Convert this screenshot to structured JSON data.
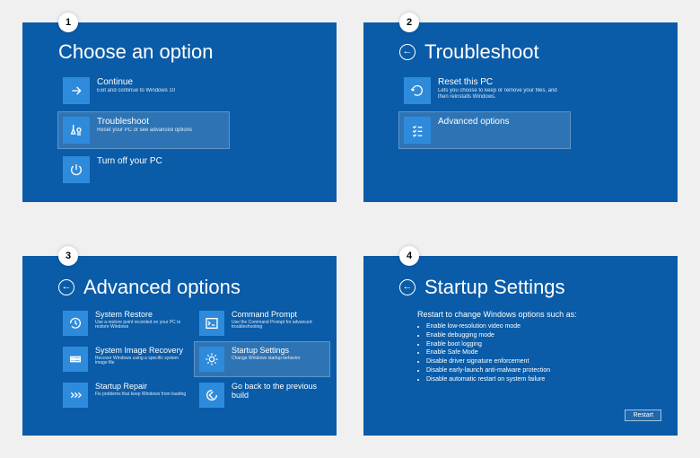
{
  "steps": [
    "1",
    "2",
    "3",
    "4"
  ],
  "panel1": {
    "title": "Choose an option",
    "tiles": [
      {
        "icon": "arrow-right-icon",
        "label": "Continue",
        "desc": "Exit and continue to Windows 10",
        "sel": false
      },
      {
        "icon": "tools-icon",
        "label": "Troubleshoot",
        "desc": "Reset your PC or see advanced options",
        "sel": true
      },
      {
        "icon": "power-icon",
        "label": "Turn off your PC",
        "desc": "",
        "sel": false
      }
    ]
  },
  "panel2": {
    "title": "Troubleshoot",
    "tiles": [
      {
        "icon": "reset-icon",
        "label": "Reset this PC",
        "desc": "Lets you choose to keep or remove your files, and then reinstalls Windows.",
        "sel": false
      },
      {
        "icon": "list-icon",
        "label": "Advanced options",
        "desc": "",
        "sel": true
      }
    ]
  },
  "panel3": {
    "title": "Advanced options",
    "tiles": [
      {
        "icon": "restore-icon",
        "label": "System Restore",
        "desc": "Use a restore point recorded on your PC to restore Windows"
      },
      {
        "icon": "cmd-icon",
        "label": "Command Prompt",
        "desc": "Use the Command Prompt for advanced troubleshooting"
      },
      {
        "icon": "image-icon",
        "label": "System Image Recovery",
        "desc": "Recover Windows using a specific system image file"
      },
      {
        "icon": "gear-icon",
        "label": "Startup Settings",
        "desc": "Change Windows startup behavior",
        "sel": true
      },
      {
        "icon": "repair-icon",
        "label": "Startup Repair",
        "desc": "Fix problems that keep Windows from loading"
      },
      {
        "icon": "back-build-icon",
        "label": "Go back to the previous build",
        "desc": ""
      }
    ]
  },
  "panel4": {
    "title": "Startup Settings",
    "subtitle": "Restart to change Windows options such as:",
    "bullets": [
      "Enable low-resolution video mode",
      "Enable debugging mode",
      "Enable boot logging",
      "Enable Safe Mode",
      "Disable driver signature enforcement",
      "Disable early-launch anti-malware protection",
      "Disable automatic restart on system failure"
    ],
    "restart": "Restart"
  }
}
